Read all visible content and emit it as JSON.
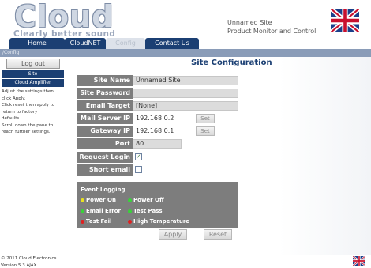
{
  "brand": {
    "logo_main": "Cloud",
    "logo_sub": "Clearly better sound"
  },
  "header": {
    "site_name": "Unnamed Site",
    "product": "Product Monitor and Control",
    "flag_icon": "uk-flag-icon"
  },
  "tabs": [
    {
      "label": "Home",
      "active": false
    },
    {
      "label": "CloudNET",
      "active": false
    },
    {
      "label": "Config",
      "active": true
    },
    {
      "label": "Contact Us",
      "active": false
    }
  ],
  "breadcrumb": "/Config",
  "sidebar": {
    "logout_label": "Log out",
    "items": [
      {
        "label": "Site"
      },
      {
        "label": "Cloud Amplifier"
      }
    ],
    "help_lines": [
      "Adjust the settings then",
      "click Apply.",
      "Click reset then apply to",
      "return to factory",
      "defaults.",
      "Scroll down the pane to",
      "reach further settings."
    ]
  },
  "page": {
    "title": "Site Configuration"
  },
  "form": {
    "site_name": {
      "label": "Site Name",
      "value": "Unnamed Site"
    },
    "site_password": {
      "label": "Site Password",
      "value": ""
    },
    "email_target": {
      "label": "Email Target",
      "value": "[None]"
    },
    "mail_server_ip": {
      "label": "Mail Server IP",
      "value": "192.168.0.2",
      "button": "Set"
    },
    "gateway_ip": {
      "label": "Gateway IP",
      "value": "192.168.0.1",
      "button": "Set"
    },
    "port": {
      "label": "Port",
      "value": "80"
    },
    "request_login": {
      "label": "Request Login",
      "checked": true
    },
    "short_email_format": {
      "label": "Short email format",
      "checked": false
    }
  },
  "event_logging": {
    "title": "Event Logging",
    "events": [
      {
        "label": "Power On",
        "color": "#e8e020"
      },
      {
        "label": "Power Off",
        "color": "#39d23a"
      },
      {
        "label": "Email Error",
        "color": "#39d23a"
      },
      {
        "label": "Test Pass",
        "color": "#39d23a"
      },
      {
        "label": "Test Fail",
        "color": "#e02020"
      },
      {
        "label": "High Temperature",
        "color": "#e02020"
      }
    ]
  },
  "actions": {
    "apply": "Apply",
    "reset": "Reset"
  },
  "footer": {
    "copyright": "© 2011 Cloud Electronics",
    "version": "Version 5.3 AJAX"
  },
  "colors": {
    "nav_dark": "#1b3f73",
    "label_bg": "#7d7d7d",
    "crumb_bg": "#8a9cb8"
  }
}
